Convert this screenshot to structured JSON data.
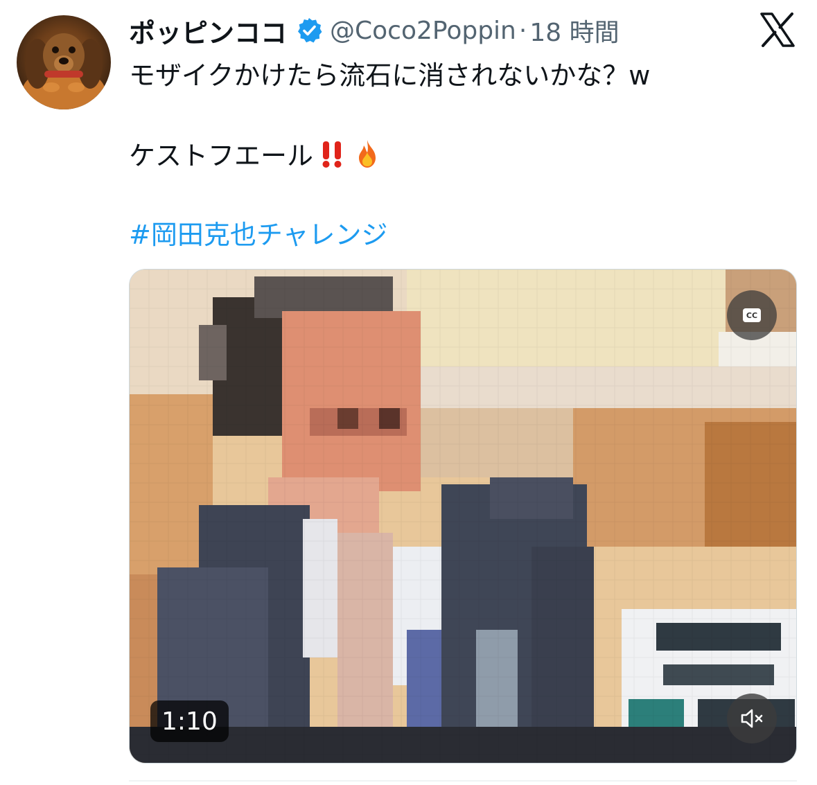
{
  "tweet": {
    "author_name": "ポッピンココ",
    "verified": true,
    "handle": "@Coco2Poppin",
    "separator": "·",
    "time_ago": "18 時間",
    "text_line1": "モザイクかけたら流石に消されないかな？w",
    "text_line2": "ケストフエール",
    "emojis": [
      "double-exclamation-icon",
      "fire-icon"
    ],
    "hashtag": "#岡田克也チャレンジ"
  },
  "avatar": {
    "icon": "dog-avatar-icon"
  },
  "platform": {
    "icon": "x-logo-icon"
  },
  "video": {
    "duration": "1:10",
    "cc_label": "CC",
    "muted": true
  },
  "colors": {
    "link": "#1d9bf0",
    "verified_badge": "#1d9bf0",
    "secondary_text": "#536471",
    "primary_text": "#0f1419"
  }
}
